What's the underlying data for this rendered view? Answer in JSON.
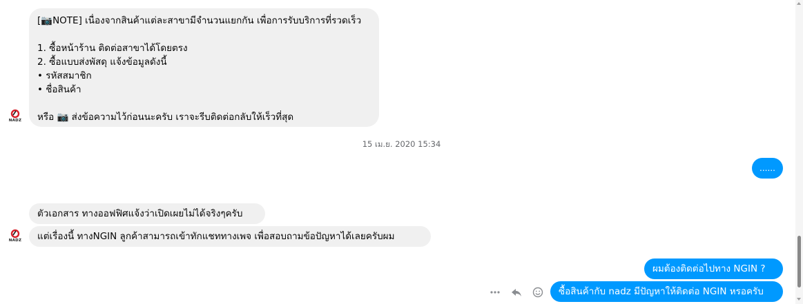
{
  "conversation": {
    "contact": {
      "avatar_label": "NADZ"
    },
    "first_message": {
      "lines": [
        "[📷NOTE] เนื่องจากสินค้าแต่ละสาขามีจำนวนแยกกัน เพื่อการรับบริการที่รวดเร็ว",
        "",
        "1. ซื้อหน้าร้าน ติดต่อสาขาได้โดยตรง",
        "2. ซื้อแบบส่งพัสดุ แจ้งข้อมูลดังนี้",
        "• รหัสสมาชิก",
        "• ชื่อสินค้า",
        "",
        "หรือ 📷 ส่งข้อความไว้ก่อนนะครับ เราจะรีบติดต่อกลับให้เร็วที่สุด"
      ]
    },
    "timestamp": "15 เม.ย. 2020 15:34",
    "outgoing_1": "......",
    "incoming_2": "ตัวเอกสาร ทางออฟฟิศแจ้งว่าเปิดเผยไม่ได้จริงๆครับ",
    "incoming_3": "แต่เรื่องนี้ ทางNGIN ลูกค้าสามารถเข้าทักแชททางเพจ เพื่อสอบถามข้อปัญหาได้เลยครับผม",
    "outgoing_2": "ผมต้องติดต่อไปทาง NGIN ?",
    "outgoing_3": "ซื้อสินค้ากับ nadz มีปัญหาให้ติดต่อ NGIN หรอครับ"
  },
  "message_actions": [
    "more-icon",
    "reply-icon",
    "react-icon"
  ],
  "colors": {
    "outgoing_bubble": "#0099ff",
    "incoming_bubble": "#f0f0f0",
    "brand_red": "#d6202a"
  }
}
